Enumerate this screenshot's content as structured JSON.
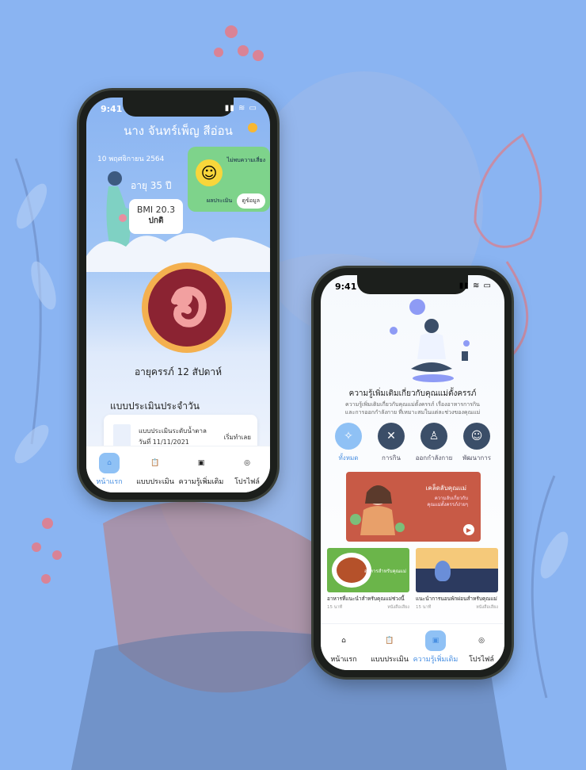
{
  "status": {
    "time": "9:41",
    "icons": "▮▮ ≋ ▭"
  },
  "home": {
    "name": "นาง จันทร์เพ็ญ  สีอ่อน",
    "date": "10  พฤศจิกายน 2564",
    "age": "อายุ 35 ปี",
    "bmi_value": "BMI 20.3",
    "bmi_status": "ปกติ",
    "mood_risk": "ไม่พบความเสี่ยง",
    "mood_eval": "ผลประเมิน",
    "mood_button": "ดูข้อมูล",
    "pregnancy": "อายุครรภ์ 12  สัปดาห์",
    "daily_title": "แบบประเมินประจำวัน",
    "assess_line1": "แบบประเมินระดับน้ำตาล",
    "assess_line2": "วันที่ 11/11/2021",
    "assess_button": "เริ่มทำเลย"
  },
  "knowledge": {
    "title": "ความรู้เพิ่มเติมเกี่ยวกับคุณแม่ตั้งครรภ์",
    "sub1": "ความรู้เพิ่มเติมเกี่ยวกับคุณแม่ตั้งครรภ์ เรื่องอาหารการกิน",
    "sub2": "และการออกกำลังกาย ที่เหมาะสมในแต่ละช่วงของคุณแม่",
    "categories": [
      "ทั้งหมด",
      "การกิน",
      "ออกกำลังกาย",
      "พัฒนาการ"
    ],
    "banner_title": "เคล็ดลับคุณแม่",
    "banner_sub1": "ความลับเกี่ยวกับ",
    "banner_sub2": "คุณแม่ตั้งครรภ์ง่ายๆ",
    "card1_overlay": "อาหารสำหรับคุณแม่",
    "card1_title": "อาหารที่แนะนำสำหรับคุณแม่ช่วงนี้",
    "card1_meta": "15 นาที",
    "card1_tag": "หนังสือเสียง",
    "card2_title": "แนะนำการนอนพักผ่อนสำหรับคุณแม่",
    "card2_meta": "15 นาที",
    "card2_tag": "หนังสือเสียง"
  },
  "tabs": [
    "หน้าแรก",
    "แบบประเมิน",
    "ความรู้เพิ่มเติม",
    "โปรไฟล์"
  ],
  "colors": {
    "background": "#8ab4f2",
    "accent": "#4a90e2",
    "mood_card": "#7ed38b",
    "banner": "#c85a46"
  }
}
